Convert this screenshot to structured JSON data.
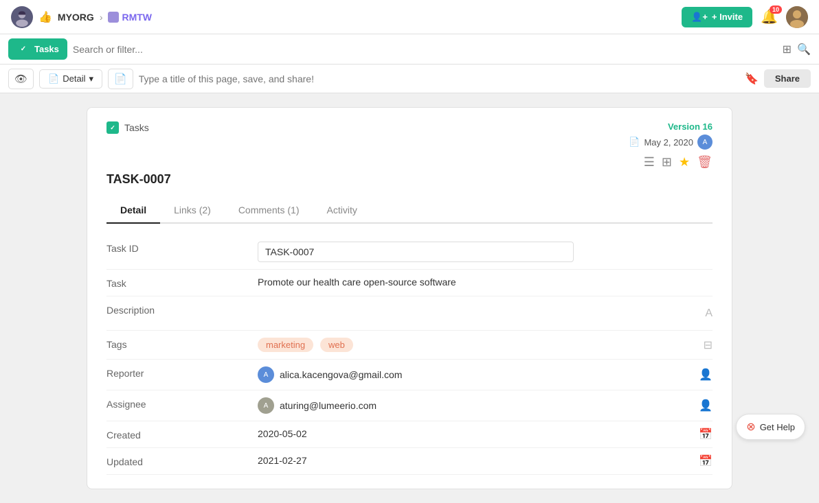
{
  "app": {
    "org_name": "MYORG",
    "project_name": "RMTW",
    "invite_label": "+ Invite",
    "notif_count": "10",
    "search_placeholder": "Search or filter...",
    "toolbar": {
      "tasks_label": "Tasks",
      "detail_label": "Detail",
      "title_placeholder": "Type a title of this page, save, and share!",
      "share_label": "Share"
    }
  },
  "task": {
    "breadcrumb": "Tasks",
    "task_id": "TASK-0007",
    "version": "Version 16",
    "date": "May 2, 2020",
    "tabs": [
      {
        "id": "detail",
        "label": "Detail",
        "active": true
      },
      {
        "id": "links",
        "label": "Links (2)",
        "active": false
      },
      {
        "id": "comments",
        "label": "Comments (1)",
        "active": false
      },
      {
        "id": "activity",
        "label": "Activity",
        "active": false
      }
    ],
    "fields": {
      "task_id": {
        "label": "Task ID",
        "value": "TASK-0007"
      },
      "task": {
        "label": "Task",
        "value": "Promote our health care open-source software"
      },
      "description": {
        "label": "Description",
        "value": ""
      },
      "tags": {
        "label": "Tags",
        "values": [
          "marketing",
          "web"
        ]
      },
      "reporter": {
        "label": "Reporter",
        "email": "alica.kacengova@gmail.com"
      },
      "assignee": {
        "label": "Assignee",
        "email": "aturing@lumeerio.com"
      },
      "created": {
        "label": "Created",
        "value": "2020-05-02"
      },
      "updated": {
        "label": "Updated",
        "value": "2021-02-27"
      }
    }
  },
  "get_help": "Get Help"
}
